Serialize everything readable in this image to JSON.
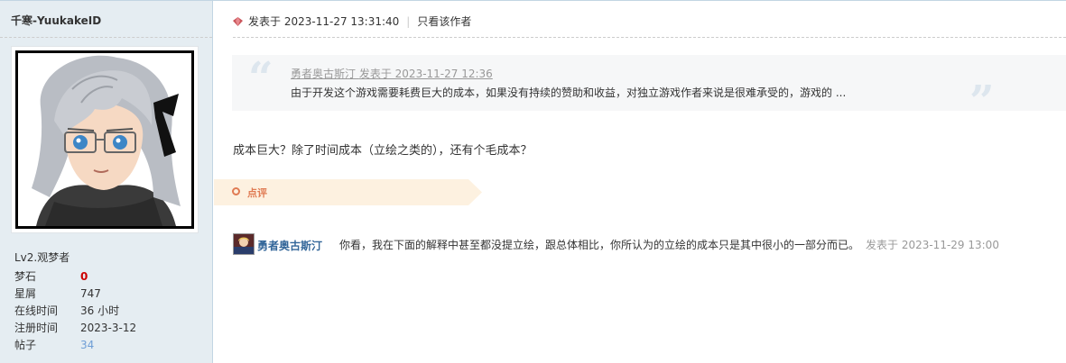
{
  "author": {
    "username": "千寒-YuukakeID",
    "level": "Lv2.观梦者",
    "stats": [
      {
        "label": "梦石",
        "value": "0"
      },
      {
        "label": "星屑",
        "value": "747"
      },
      {
        "label": "在线时间",
        "value": "36 小时"
      },
      {
        "label": "注册时间",
        "value": "2023-3-12"
      },
      {
        "label": "帖子",
        "value": "34"
      }
    ]
  },
  "post": {
    "posted_prefix": "发表于",
    "posted_time": "2023-11-27 13:31:40",
    "only_author": "只看该作者",
    "quote": {
      "author": "勇者奥古斯汀",
      "posted": "发表于 2023-11-27 12:36",
      "text": "由于开发这个游戏需要耗费巨大的成本，如果没有持续的赞助和收益，对独立游戏作者来说是很难承受的，游戏的 ..."
    },
    "body": "成本巨大？除了时间成本（立绘之类的），还有个毛成本？"
  },
  "rating": {
    "label": "点评"
  },
  "comment": {
    "author": "勇者奥古斯汀",
    "text": "你看，我在下面的解释中甚至都没提立绘，跟总体相比，你所认为的立绘的成本只是其中很小的一部分而已。",
    "time": "发表于 2023-11-29 13:00"
  }
}
